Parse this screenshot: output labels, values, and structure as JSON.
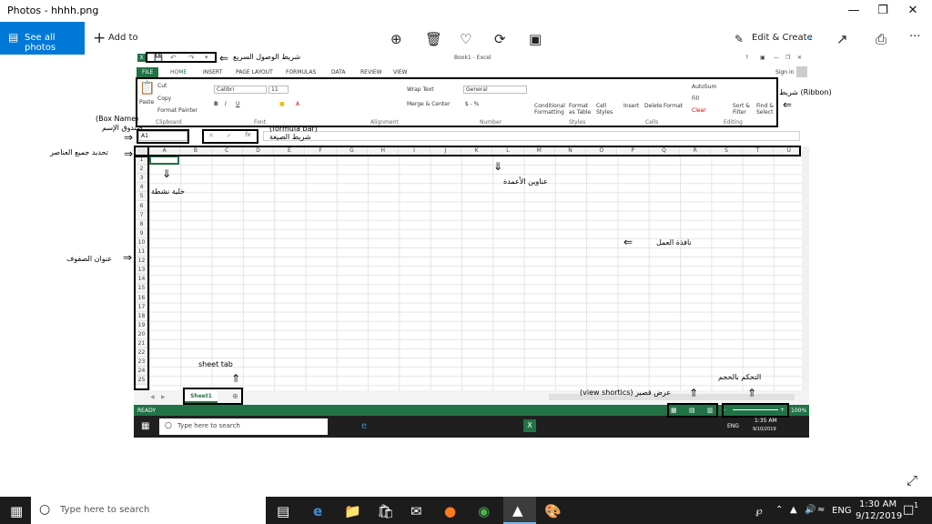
{
  "app": {
    "title": "Photos - hhhh.png",
    "see_all_label": "See all photos",
    "add_to_label": "Add to",
    "edit_create_label": "Edit & Create",
    "more_label": "···"
  },
  "excel": {
    "title": "Book1 - Excel",
    "sign_in": "Sign in",
    "tabs": [
      "FILE",
      "HOME",
      "INSERT",
      "PAGE LAYOUT",
      "FORMULAS",
      "DATA",
      "REVIEW",
      "VIEW"
    ],
    "clipboard": {
      "paste": "Paste",
      "cut": "Cut",
      "copy": "Copy",
      "format_painter": "Format Painter",
      "group": "Clipboard"
    },
    "font": {
      "name": "Calibri",
      "size": "11",
      "group": "Font"
    },
    "alignment": {
      "wrap": "Wrap Text",
      "merge": "Merge & Center",
      "group": "Alignment"
    },
    "number": {
      "format": "General",
      "group": "Number"
    },
    "styles": {
      "conditional": "Conditional Formatting",
      "format_table": "Format as Table",
      "cell_styles": "Cell Styles",
      "group": "Styles"
    },
    "cells": {
      "insert": "Insert",
      "delete": "Delete",
      "format": "Format",
      "group": "Cells"
    },
    "editing": {
      "autosum": "AutoSum",
      "fill": "Fill",
      "clear": "Clear",
      "sort": "Sort & Filter",
      "find": "Find & Select",
      "group": "Editing"
    },
    "name_box": "A1",
    "columns": [
      "A",
      "B",
      "C",
      "D",
      "E",
      "F",
      "G",
      "H",
      "I",
      "J",
      "K",
      "L",
      "M",
      "N",
      "O",
      "P",
      "Q",
      "R",
      "S",
      "T",
      "U"
    ],
    "rows": [
      "1",
      "2",
      "3",
      "4",
      "5",
      "6",
      "7",
      "8",
      "9",
      "10",
      "11",
      "12",
      "13",
      "14",
      "15",
      "16",
      "17",
      "18",
      "19",
      "20",
      "21",
      "22",
      "23",
      "24",
      "25"
    ],
    "sheet_tab": "Sheet1",
    "status": "READY",
    "zoom": "100%",
    "inner_search": "Type here to search",
    "inner_time": "1:35 AM",
    "inner_date": "9/10/2019",
    "inner_lang": "ENG"
  },
  "annotations": {
    "quick_access": "شريط الوصول السريع",
    "ribbon": "شريط (Ribbon)",
    "name_box_en": "(Box Name)",
    "name_box_ar": "صندوق الإسم",
    "formula_bar_en": "(formula bar)",
    "formula_bar_ar": "شريط الصيغة",
    "select_all": "تحديد جميع العناصر",
    "active_cell": "خلية نشطة",
    "column_headings": "عناوين الأعمدة",
    "work_window": "نافذة العمل",
    "row_headings": "عنوان الصفوف",
    "sheet_tab": "sheet tab",
    "view_shortcuts": "(view shortics)  عرض قصير",
    "zoom_control": "التحكم بالحجم"
  },
  "taskbar": {
    "search_placeholder": "Type here to search",
    "lang": "ENG",
    "time": "1:30 AM",
    "date": "9/12/2019",
    "notification_count": "1"
  },
  "colors": {
    "accent": "#0078d7",
    "excel_green": "#217346",
    "taskbar": "#1c1c1c"
  }
}
